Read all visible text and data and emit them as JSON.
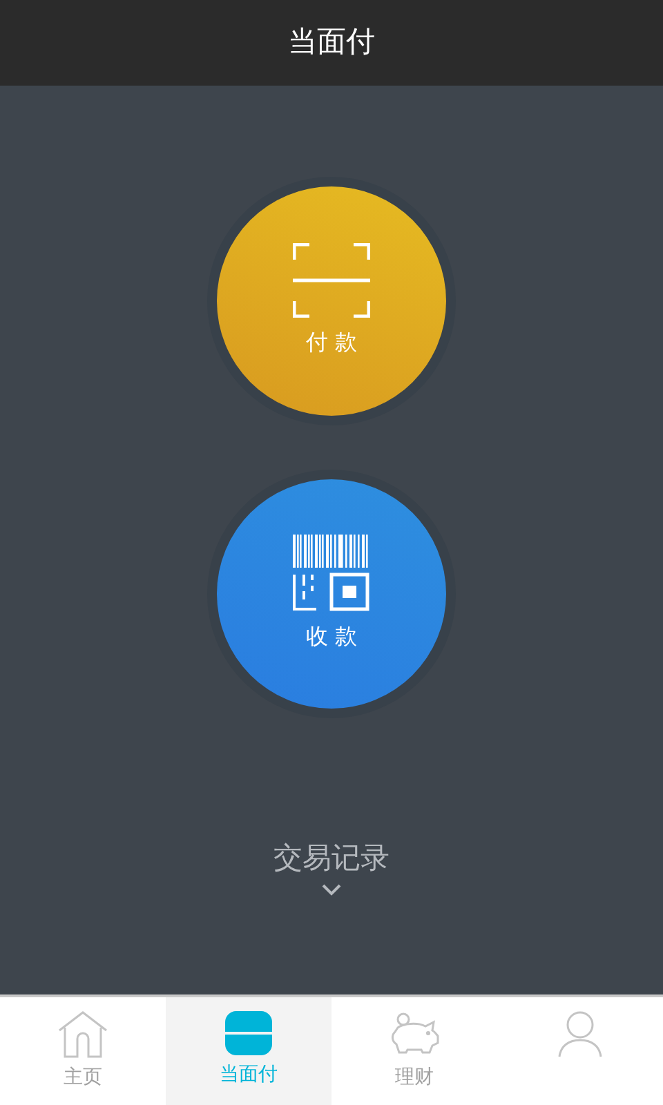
{
  "header": {
    "title": "当面付"
  },
  "actions": [
    {
      "kind": "pay",
      "label": "付 款"
    },
    {
      "kind": "receive",
      "label": "收 款"
    }
  ],
  "records": {
    "label": "交易记录"
  },
  "tabs": [
    {
      "kind": "home",
      "label": "主页",
      "selected": false
    },
    {
      "kind": "pay",
      "label": "当面付",
      "selected": true
    },
    {
      "kind": "wealth",
      "label": "理财",
      "selected": false
    },
    {
      "kind": "profile",
      "selected": false
    }
  ]
}
